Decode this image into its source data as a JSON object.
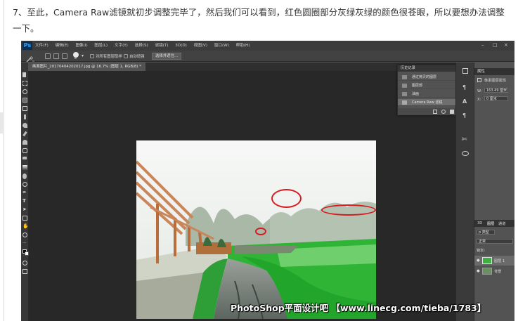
{
  "article": {
    "step_text": "7、至此，Camera Raw滤镜就初步调整完毕了，然后我们可以看到，红色圆圈部分灰绿灰绿的颜色很苍眼，所以要想办法调整一下。"
  },
  "photoshop": {
    "logo": "Ps",
    "menu": [
      "文件(F)",
      "编辑(E)",
      "图像(I)",
      "图层(L)",
      "文字(Y)",
      "选择(S)",
      "滤镜(T)",
      "3D(D)",
      "视图(V)",
      "窗口(W)",
      "帮助(H)"
    ],
    "window_controls": [
      "–",
      "□",
      "×"
    ],
    "options_bar": {
      "brush_size": "8",
      "sample_all_layers": "对所有图层取样",
      "auto_enhance": "自动增强",
      "select_and_mask": "选择并遮住..."
    },
    "document_tab": "画面图片_20170404202017.jpg @ 16.7% (图层 1, RGB/8) *",
    "history_panel": {
      "title": "历史记录",
      "items": [
        "通过拷贝的图层",
        "图层部",
        "油画",
        "Camera Raw 滤镜"
      ]
    },
    "properties_panel": {
      "title": "属性",
      "subtitle": "像素图层属性",
      "w_label": "W:",
      "w_value": "163.49 厘米",
      "x_label": "X:",
      "x_value": "0 厘米"
    },
    "layers_panel": {
      "tabs": [
        "3D",
        "图层",
        "通道"
      ],
      "kind_filter": "p 类型",
      "blend_mode": "正常",
      "lock_label": "锁定:",
      "layers": [
        {
          "name": "图层 1"
        },
        {
          "name": "背景"
        }
      ]
    }
  },
  "colors": {
    "annotation_red": "#d71920",
    "ps_panel": "#535353",
    "ps_dark": "#282828"
  },
  "watermark": "PhotoShop平面设计吧 【www.linecg.com/tieba/1783】"
}
